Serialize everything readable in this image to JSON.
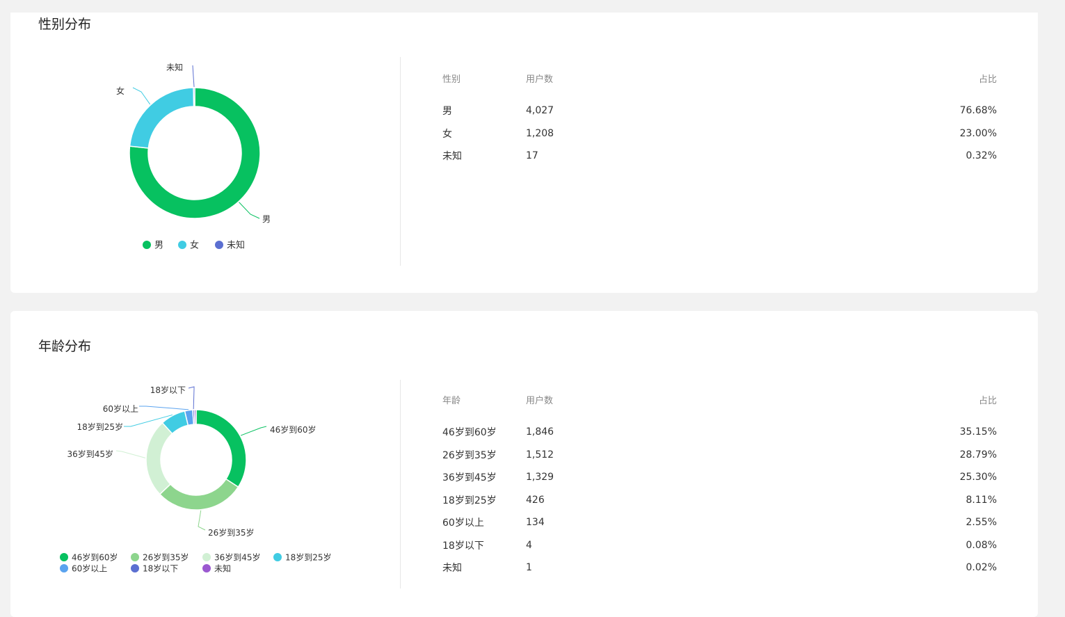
{
  "gender_section": {
    "title": "性别分布",
    "table": {
      "headers": [
        "性别",
        "用户数",
        "占比"
      ],
      "rows": [
        [
          "男",
          "4,027",
          "76.68%"
        ],
        [
          "女",
          "1,208",
          "23.00%"
        ],
        [
          "未知",
          "17",
          "0.32%"
        ]
      ]
    },
    "legend": [
      "男",
      "女",
      "未知"
    ]
  },
  "age_section": {
    "title": "年龄分布",
    "table": {
      "headers": [
        "年龄",
        "用户数",
        "占比"
      ],
      "rows": [
        [
          "46岁到60岁",
          "1,846",
          "35.15%"
        ],
        [
          "26岁到35岁",
          "1,512",
          "28.79%"
        ],
        [
          "36岁到45岁",
          "1,329",
          "25.30%"
        ],
        [
          "18岁到25岁",
          "426",
          "8.11%"
        ],
        [
          "60岁以上",
          "134",
          "2.55%"
        ],
        [
          "18岁以下",
          "4",
          "0.08%"
        ],
        [
          "未知",
          "1",
          "0.02%"
        ]
      ]
    },
    "legend": [
      "46岁到60岁",
      "26岁到35岁",
      "36岁到45岁",
      "18岁到25岁",
      "60岁以上",
      "18岁以下",
      "未知"
    ]
  },
  "chart_data": [
    {
      "type": "pie",
      "categories": [
        "男",
        "女",
        "未知"
      ],
      "values": [
        4027,
        1208,
        17
      ],
      "colors": [
        "#07c160",
        "#40cce3",
        "#5b6fd1"
      ],
      "legend_position": "bottom"
    },
    {
      "type": "pie",
      "categories": [
        "46岁到60岁",
        "26岁到35岁",
        "36岁到45岁",
        "18岁到25岁",
        "60岁以上",
        "18岁以下",
        "未知"
      ],
      "values": [
        1846,
        1512,
        1329,
        426,
        134,
        4,
        1
      ],
      "colors": [
        "#07c160",
        "#8dd58d",
        "#d1f0d4",
        "#40cce3",
        "#5aa3ef",
        "#5b6fd1",
        "#9b59d0"
      ],
      "legend_position": "bottom"
    }
  ]
}
